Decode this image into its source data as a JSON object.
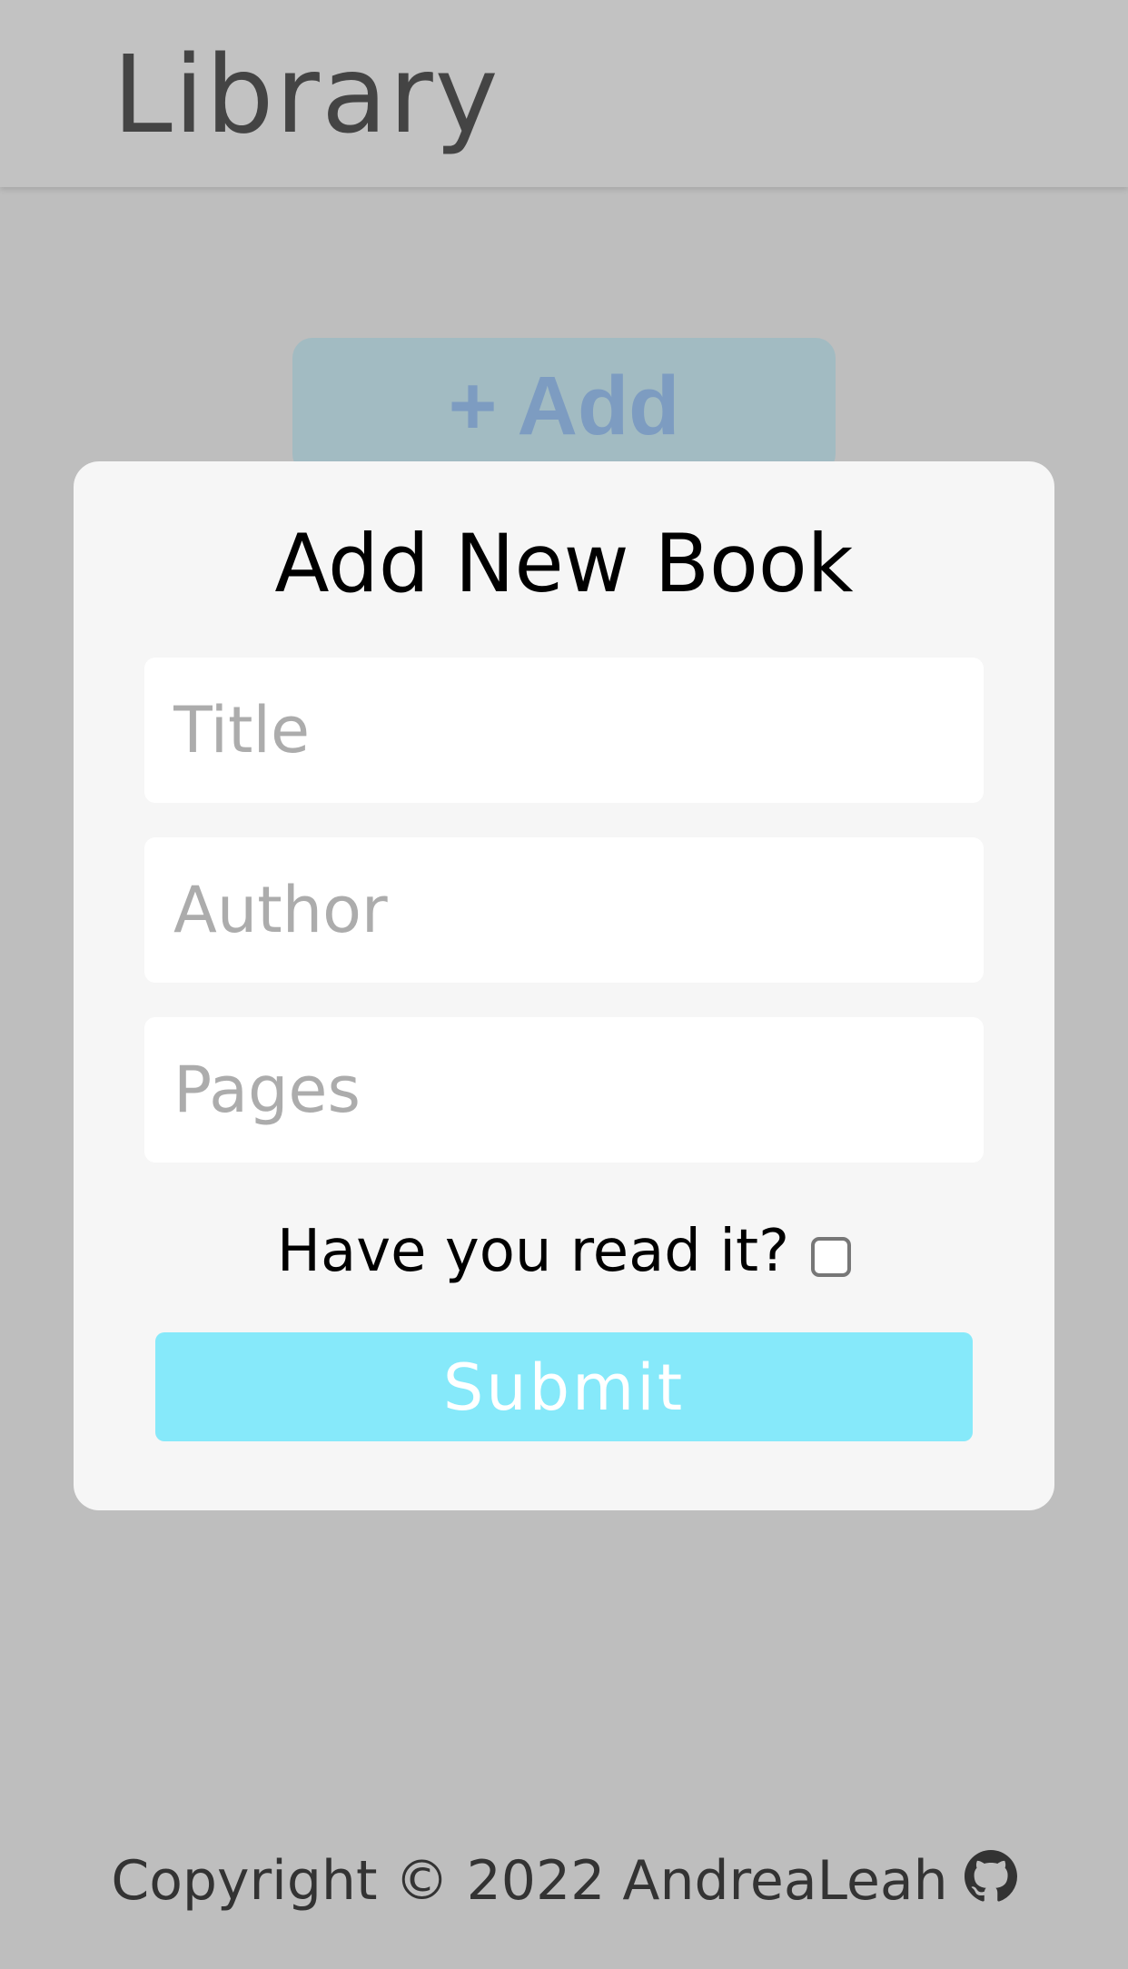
{
  "header": {
    "title": "Library"
  },
  "add_button": {
    "label": "+ Add"
  },
  "modal": {
    "title": "Add New Book",
    "fields": {
      "title": {
        "placeholder": "Title",
        "value": ""
      },
      "author": {
        "placeholder": "Author",
        "value": ""
      },
      "pages": {
        "placeholder": "Pages",
        "value": ""
      }
    },
    "read_label": "Have you read it?",
    "read_checked": false,
    "submit_label": "Submit"
  },
  "footer": {
    "text": "Copyright © 2022 AndreaLeah",
    "icon": "github-icon"
  },
  "colors": {
    "backdrop": "#bebebe",
    "modal": "#f6f6f6",
    "submit": "#86e9fa",
    "add_button": "#a2bbc2",
    "add_button_text": "#7d9cc1"
  }
}
